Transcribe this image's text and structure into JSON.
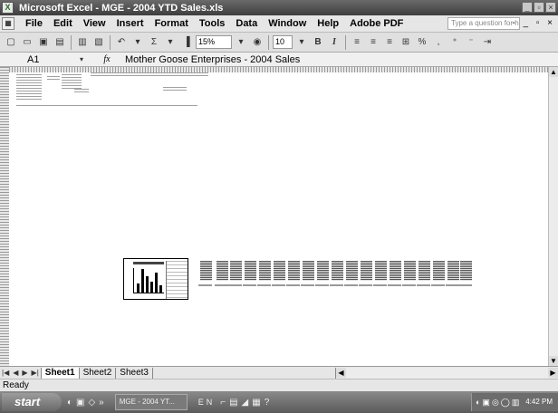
{
  "window": {
    "title": "Microsoft Excel - MGE - 2004 YTD Sales.xls",
    "controls": [
      "_",
      "▫",
      "×"
    ]
  },
  "menu": {
    "items": [
      "File",
      "Edit",
      "View",
      "Insert",
      "Format",
      "Tools",
      "Data",
      "Window",
      "Help",
      "Adobe PDF"
    ],
    "help_placeholder": "Type a question for help",
    "doc_controls": "- _ ▫ ×"
  },
  "toolbar": {
    "zoom": "15%",
    "font_size": "10",
    "bold": "B",
    "italic": "I",
    "percent": "%",
    "sum": "Σ"
  },
  "formula_bar": {
    "cell_ref": "A1",
    "fx": "fx",
    "content": "Mother Goose Enterprises - 2004 Sales"
  },
  "sheet_tabs": [
    {
      "label": "Sheet1",
      "active": true
    },
    {
      "label": "Sheet2",
      "active": false
    },
    {
      "label": "Sheet3",
      "active": false
    }
  ],
  "status": {
    "text": "Ready"
  },
  "taskbar": {
    "start": "start",
    "task": "MGE - 2004 YT...",
    "lang": "EN",
    "time": "4:42 PM"
  }
}
